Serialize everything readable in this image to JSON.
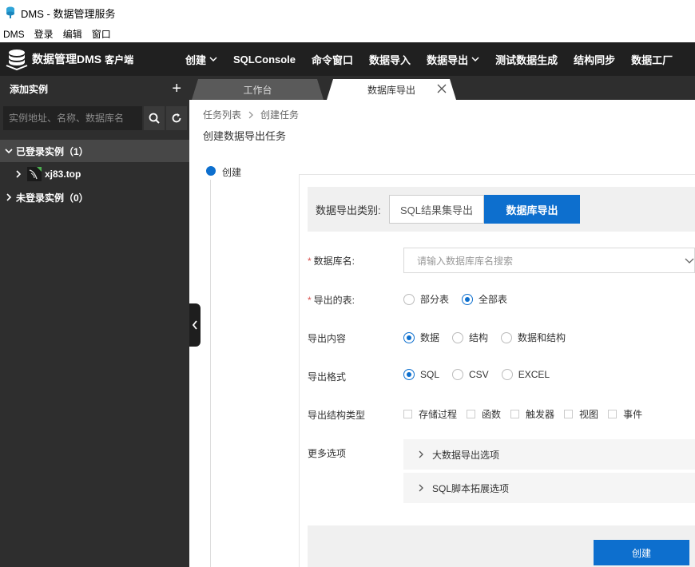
{
  "window": {
    "title": "DMS - 数据管理服务"
  },
  "menubar": {
    "items": [
      "DMS",
      "登录",
      "编辑",
      "窗口"
    ]
  },
  "brand": {
    "title": "数据管理DMS",
    "subtitle": "客户端"
  },
  "topnav": {
    "items": [
      {
        "label": "创建",
        "dropdown": true
      },
      {
        "label": "SQLConsole",
        "dropdown": false
      },
      {
        "label": "命令窗口",
        "dropdown": false
      },
      {
        "label": "数据导入",
        "dropdown": false
      },
      {
        "label": "数据导出",
        "dropdown": true
      },
      {
        "label": "测试数据生成",
        "dropdown": false
      },
      {
        "label": "结构同步",
        "dropdown": false
      },
      {
        "label": "数据工厂",
        "dropdown": false
      }
    ]
  },
  "sidebar": {
    "header": "添加实例",
    "search_placeholder": "实例地址、名称、数据库名",
    "logged_group": "已登录实例（1）",
    "instance": "xj83.top",
    "unlogged_group": "未登录实例（0）"
  },
  "tabs": [
    {
      "label": "工作台"
    },
    {
      "label": "数据库导出"
    }
  ],
  "breadcrumb": {
    "parent": "任务列表",
    "current": "创建任务"
  },
  "page": {
    "title": "创建数据导出任务",
    "step": "创建"
  },
  "form": {
    "type_label": "数据导出类别:",
    "type_options": [
      "SQL结果集导出",
      "数据库导出"
    ],
    "db_label": "数据库名:",
    "db_placeholder": "请输入数据库库名搜索",
    "tables_label": "导出的表:",
    "tables_options": [
      "部分表",
      "全部表"
    ],
    "content_label": "导出内容",
    "content_options": [
      "数据",
      "结构",
      "数据和结构"
    ],
    "format_label": "导出格式",
    "format_options": [
      "SQL",
      "CSV",
      "EXCEL"
    ],
    "struct_label": "导出结构类型",
    "struct_options": [
      "存储过程",
      "函数",
      "触发器",
      "视图",
      "事件"
    ],
    "more_label": "更多选项",
    "more_items": [
      "大数据导出选项",
      "SQL脚本拓展选项"
    ],
    "submit": "创建"
  },
  "colors": {
    "accent": "#0d6fce",
    "nav_bg": "#202020",
    "sidebar_bg": "#2e2e2e"
  }
}
